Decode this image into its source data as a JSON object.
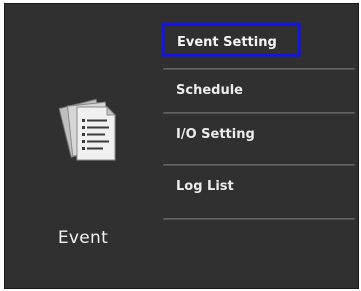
{
  "panel": {
    "title": "Event",
    "icon": "event-documents-icon"
  },
  "menu": {
    "selected_index": 0,
    "highlight_color": "#1414e6",
    "items": [
      {
        "label": "Event Setting"
      },
      {
        "label": "Schedule"
      },
      {
        "label": "I/O Setting"
      },
      {
        "label": "Log List"
      }
    ]
  }
}
